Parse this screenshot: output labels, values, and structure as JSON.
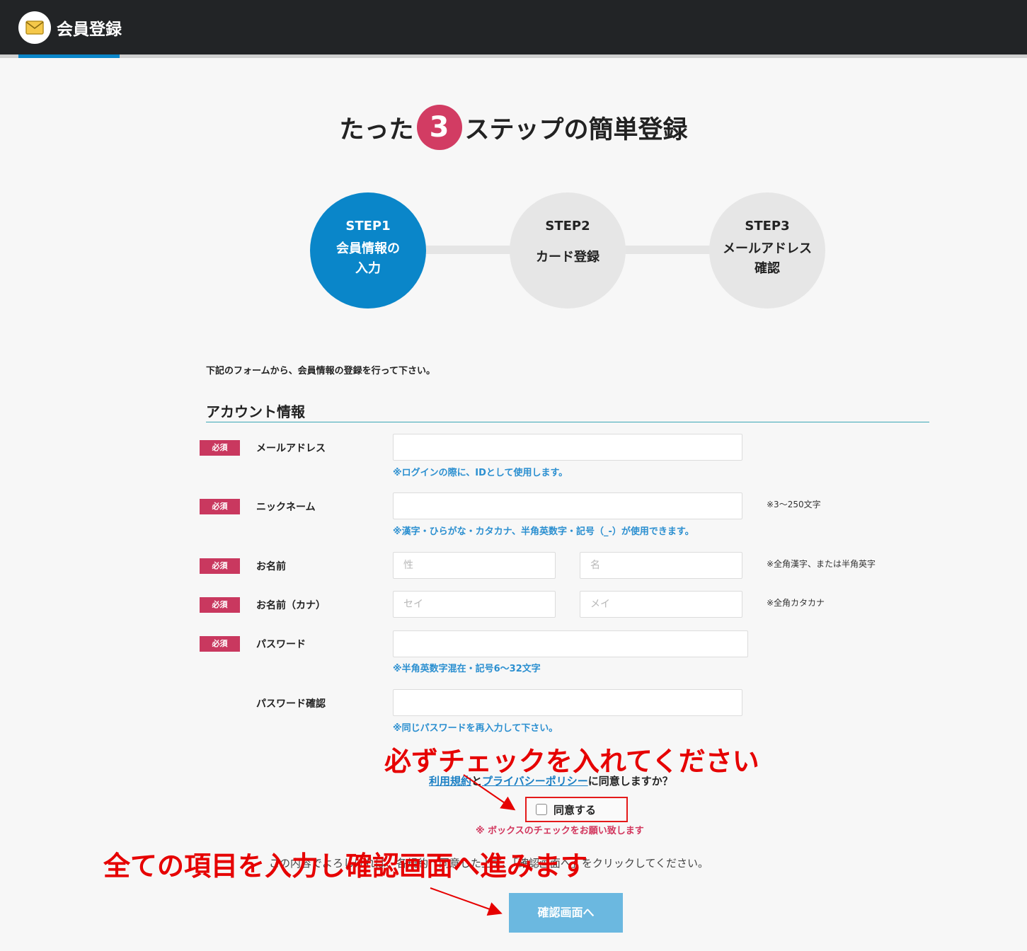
{
  "header": {
    "icon": "mail-envelope-icon",
    "title": "会員登録"
  },
  "headline": {
    "prefix": "たった",
    "number": "3",
    "suffix": "ステップの簡単登録"
  },
  "steps": [
    {
      "label": "STEP1",
      "line1": "会員情報の",
      "line2": "入力",
      "state": "active"
    },
    {
      "label": "STEP2",
      "line1": "カード登録",
      "line2": "",
      "state": "inactive"
    },
    {
      "label": "STEP3",
      "line1": "メールアドレス",
      "line2": "確認",
      "state": "inactive"
    }
  ],
  "intro": "下記のフォームから、会員情報の登録を行って下さい。",
  "section_title": "アカウント情報",
  "required_badge": "必須",
  "fields": {
    "email": {
      "label": "メールアドレス",
      "value": "",
      "help": "※ログインの際に、IDとして使用します。"
    },
    "nickname": {
      "label": "ニックネーム",
      "value": "",
      "side": "※3〜250文字",
      "help": "※漢字・ひらがな・カタカナ、半角英数字・記号（_-）が使用できます。"
    },
    "name": {
      "label": "お名前",
      "last_placeholder": "性",
      "first_placeholder": "名",
      "side": "※全角漢字、または半角英字"
    },
    "kana": {
      "label": "お名前（カナ）",
      "last_placeholder": "セイ",
      "first_placeholder": "メイ",
      "side": "※全角カタカナ"
    },
    "password": {
      "label": "パスワード",
      "value": "",
      "help": "※半角英数字混在・記号6〜32文字"
    },
    "password_confirm": {
      "label": "パスワード確認",
      "value": "",
      "help": "※同じパスワードを再入力して下さい。"
    }
  },
  "agreement": {
    "terms_link": "利用規約",
    "and": "と",
    "privacy_link": "プライバシーポリシー",
    "question": "に同意しますか？",
    "checkbox_label": "同意する",
    "warning": "※ ボックスのチェックをお願い致します"
  },
  "confirm_text": "この内容でよろしければ、各規約へ同意した上で、「確認画面へ」をクリックしてください。",
  "submit_label": "確認画面へ",
  "annotations": {
    "check_note": "必ずチェックを入れてください",
    "proceed_note": "全ての項目を入力し確認画面へ進みます",
    "color": "#e60000"
  },
  "colors": {
    "accent": "#0a86c9",
    "required": "#c9385f",
    "link": "#1a7fc4"
  }
}
